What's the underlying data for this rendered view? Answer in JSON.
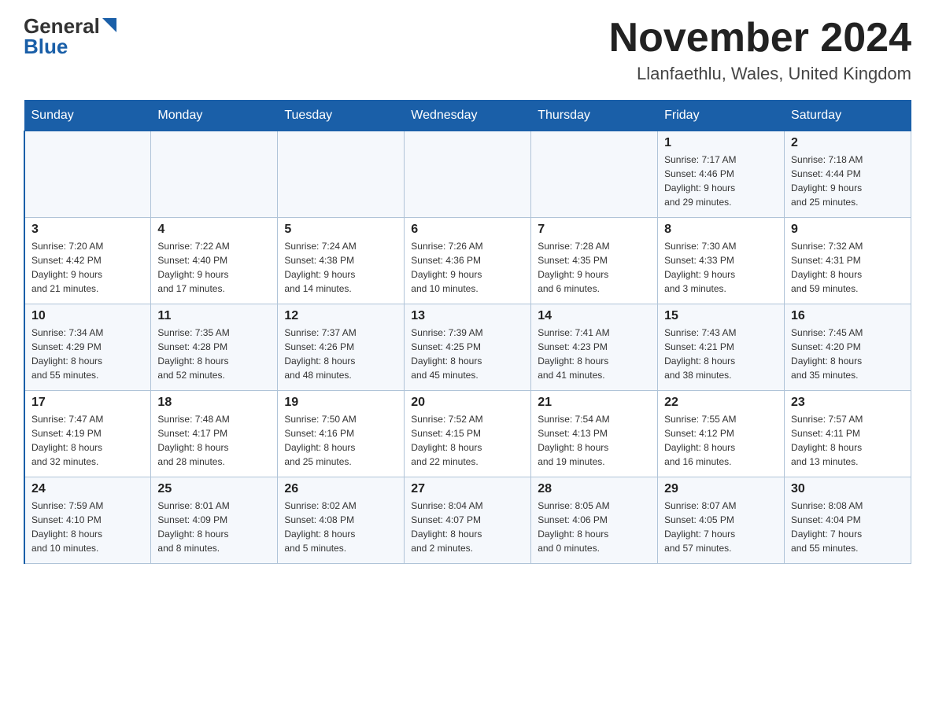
{
  "header": {
    "logo_general": "General",
    "logo_blue": "Blue",
    "month_title": "November 2024",
    "location": "Llanfaethlu, Wales, United Kingdom"
  },
  "days_of_week": [
    "Sunday",
    "Monday",
    "Tuesday",
    "Wednesday",
    "Thursday",
    "Friday",
    "Saturday"
  ],
  "weeks": [
    [
      {
        "day": "",
        "info": ""
      },
      {
        "day": "",
        "info": ""
      },
      {
        "day": "",
        "info": ""
      },
      {
        "day": "",
        "info": ""
      },
      {
        "day": "",
        "info": ""
      },
      {
        "day": "1",
        "info": "Sunrise: 7:17 AM\nSunset: 4:46 PM\nDaylight: 9 hours\nand 29 minutes."
      },
      {
        "day": "2",
        "info": "Sunrise: 7:18 AM\nSunset: 4:44 PM\nDaylight: 9 hours\nand 25 minutes."
      }
    ],
    [
      {
        "day": "3",
        "info": "Sunrise: 7:20 AM\nSunset: 4:42 PM\nDaylight: 9 hours\nand 21 minutes."
      },
      {
        "day": "4",
        "info": "Sunrise: 7:22 AM\nSunset: 4:40 PM\nDaylight: 9 hours\nand 17 minutes."
      },
      {
        "day": "5",
        "info": "Sunrise: 7:24 AM\nSunset: 4:38 PM\nDaylight: 9 hours\nand 14 minutes."
      },
      {
        "day": "6",
        "info": "Sunrise: 7:26 AM\nSunset: 4:36 PM\nDaylight: 9 hours\nand 10 minutes."
      },
      {
        "day": "7",
        "info": "Sunrise: 7:28 AM\nSunset: 4:35 PM\nDaylight: 9 hours\nand 6 minutes."
      },
      {
        "day": "8",
        "info": "Sunrise: 7:30 AM\nSunset: 4:33 PM\nDaylight: 9 hours\nand 3 minutes."
      },
      {
        "day": "9",
        "info": "Sunrise: 7:32 AM\nSunset: 4:31 PM\nDaylight: 8 hours\nand 59 minutes."
      }
    ],
    [
      {
        "day": "10",
        "info": "Sunrise: 7:34 AM\nSunset: 4:29 PM\nDaylight: 8 hours\nand 55 minutes."
      },
      {
        "day": "11",
        "info": "Sunrise: 7:35 AM\nSunset: 4:28 PM\nDaylight: 8 hours\nand 52 minutes."
      },
      {
        "day": "12",
        "info": "Sunrise: 7:37 AM\nSunset: 4:26 PM\nDaylight: 8 hours\nand 48 minutes."
      },
      {
        "day": "13",
        "info": "Sunrise: 7:39 AM\nSunset: 4:25 PM\nDaylight: 8 hours\nand 45 minutes."
      },
      {
        "day": "14",
        "info": "Sunrise: 7:41 AM\nSunset: 4:23 PM\nDaylight: 8 hours\nand 41 minutes."
      },
      {
        "day": "15",
        "info": "Sunrise: 7:43 AM\nSunset: 4:21 PM\nDaylight: 8 hours\nand 38 minutes."
      },
      {
        "day": "16",
        "info": "Sunrise: 7:45 AM\nSunset: 4:20 PM\nDaylight: 8 hours\nand 35 minutes."
      }
    ],
    [
      {
        "day": "17",
        "info": "Sunrise: 7:47 AM\nSunset: 4:19 PM\nDaylight: 8 hours\nand 32 minutes."
      },
      {
        "day": "18",
        "info": "Sunrise: 7:48 AM\nSunset: 4:17 PM\nDaylight: 8 hours\nand 28 minutes."
      },
      {
        "day": "19",
        "info": "Sunrise: 7:50 AM\nSunset: 4:16 PM\nDaylight: 8 hours\nand 25 minutes."
      },
      {
        "day": "20",
        "info": "Sunrise: 7:52 AM\nSunset: 4:15 PM\nDaylight: 8 hours\nand 22 minutes."
      },
      {
        "day": "21",
        "info": "Sunrise: 7:54 AM\nSunset: 4:13 PM\nDaylight: 8 hours\nand 19 minutes."
      },
      {
        "day": "22",
        "info": "Sunrise: 7:55 AM\nSunset: 4:12 PM\nDaylight: 8 hours\nand 16 minutes."
      },
      {
        "day": "23",
        "info": "Sunrise: 7:57 AM\nSunset: 4:11 PM\nDaylight: 8 hours\nand 13 minutes."
      }
    ],
    [
      {
        "day": "24",
        "info": "Sunrise: 7:59 AM\nSunset: 4:10 PM\nDaylight: 8 hours\nand 10 minutes."
      },
      {
        "day": "25",
        "info": "Sunrise: 8:01 AM\nSunset: 4:09 PM\nDaylight: 8 hours\nand 8 minutes."
      },
      {
        "day": "26",
        "info": "Sunrise: 8:02 AM\nSunset: 4:08 PM\nDaylight: 8 hours\nand 5 minutes."
      },
      {
        "day": "27",
        "info": "Sunrise: 8:04 AM\nSunset: 4:07 PM\nDaylight: 8 hours\nand 2 minutes."
      },
      {
        "day": "28",
        "info": "Sunrise: 8:05 AM\nSunset: 4:06 PM\nDaylight: 8 hours\nand 0 minutes."
      },
      {
        "day": "29",
        "info": "Sunrise: 8:07 AM\nSunset: 4:05 PM\nDaylight: 7 hours\nand 57 minutes."
      },
      {
        "day": "30",
        "info": "Sunrise: 8:08 AM\nSunset: 4:04 PM\nDaylight: 7 hours\nand 55 minutes."
      }
    ]
  ]
}
